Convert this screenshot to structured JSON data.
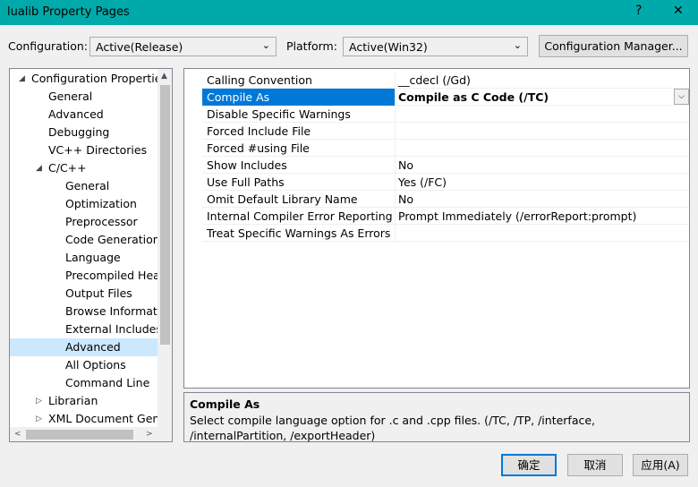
{
  "window": {
    "title": "lualib Property Pages",
    "help": "?",
    "close": "✕"
  },
  "config": {
    "label": "Configuration:",
    "value": "Active(Release)"
  },
  "platform": {
    "label": "Platform:",
    "value": "Active(Win32)"
  },
  "config_manager": "Configuration Manager...",
  "tree": {
    "items": [
      {
        "label": "Configuration Properties",
        "level": 0,
        "expander": "◢"
      },
      {
        "label": "General",
        "level": 1
      },
      {
        "label": "Advanced",
        "level": 1
      },
      {
        "label": "Debugging",
        "level": 1
      },
      {
        "label": "VC++ Directories",
        "level": 1
      },
      {
        "label": "C/C++",
        "level": 1,
        "expander": "◢"
      },
      {
        "label": "General",
        "level": 2
      },
      {
        "label": "Optimization",
        "level": 2
      },
      {
        "label": "Preprocessor",
        "level": 2
      },
      {
        "label": "Code Generation",
        "level": 2
      },
      {
        "label": "Language",
        "level": 2
      },
      {
        "label": "Precompiled Heac",
        "level": 2
      },
      {
        "label": "Output Files",
        "level": 2
      },
      {
        "label": "Browse Informatic",
        "level": 2
      },
      {
        "label": "External Includes",
        "level": 2
      },
      {
        "label": "Advanced",
        "level": 2,
        "selected": true
      },
      {
        "label": "All Options",
        "level": 2
      },
      {
        "label": "Command Line",
        "level": 2
      },
      {
        "label": "Librarian",
        "level": 1,
        "expander": "▷"
      },
      {
        "label": "XML Document Gene",
        "level": 1,
        "expander": "▷"
      }
    ]
  },
  "properties": [
    {
      "name": "Calling Convention",
      "value": "__cdecl (/Gd)"
    },
    {
      "name": "Compile As",
      "value": "Compile as C Code (/TC)",
      "selected": true
    },
    {
      "name": "Disable Specific Warnings",
      "value": ""
    },
    {
      "name": "Forced Include File",
      "value": ""
    },
    {
      "name": "Forced #using File",
      "value": ""
    },
    {
      "name": "Show Includes",
      "value": "No"
    },
    {
      "name": "Use Full Paths",
      "value": "Yes (/FC)"
    },
    {
      "name": "Omit Default Library Name",
      "value": "No"
    },
    {
      "name": "Internal Compiler Error Reporting",
      "value": "Prompt Immediately (/errorReport:prompt)"
    },
    {
      "name": "Treat Specific Warnings As Errors",
      "value": ""
    }
  ],
  "description": {
    "title": "Compile As",
    "text": "Select compile language option for .c and .cpp files.     (/TC, /TP, /interface, /internalPartition, /exportHeader)"
  },
  "buttons": {
    "ok": "确定",
    "cancel": "取消",
    "apply": "应用(A)"
  }
}
